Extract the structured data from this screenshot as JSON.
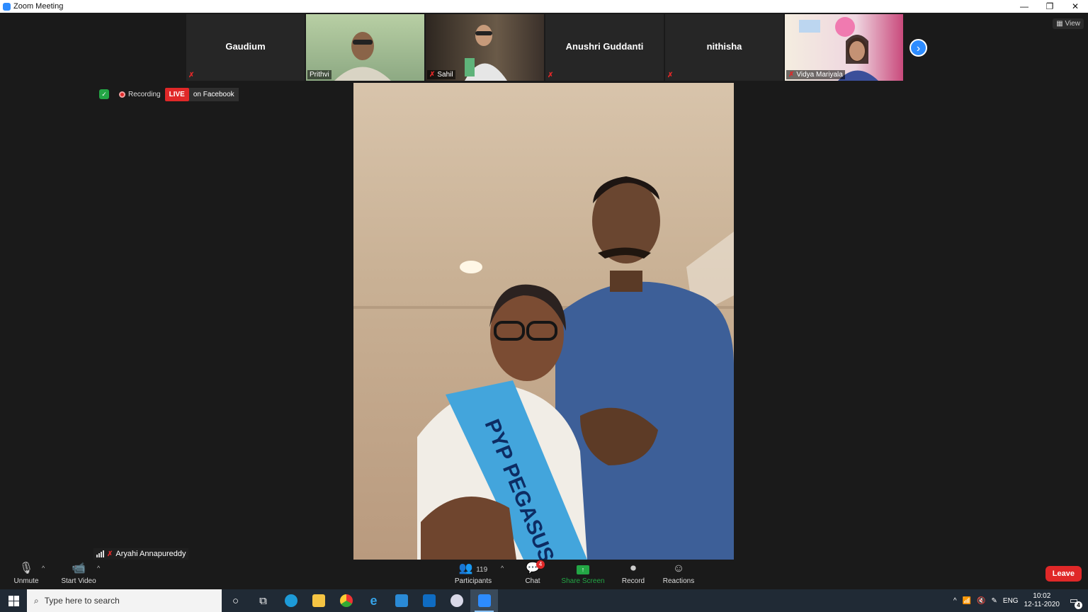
{
  "window": {
    "title": "Zoom Meeting",
    "minimize": "—",
    "restore": "❐",
    "close": "✕"
  },
  "top_right": {
    "view_label": "View"
  },
  "participants_strip": [
    {
      "name": "Gaudium",
      "type": "name-only",
      "muted": true
    },
    {
      "name": "Prithvi",
      "type": "video",
      "muted": false,
      "bg": "#9bb590"
    },
    {
      "name": "Sahil",
      "type": "video",
      "muted": true,
      "bg": "#4a4038"
    },
    {
      "name": "Anushri Guddanti",
      "type": "name-only",
      "muted": true
    },
    {
      "name": "nithisha",
      "type": "name-only",
      "muted": true
    },
    {
      "name": "Vidya Mariyala",
      "type": "video",
      "muted": true,
      "bg": "#d9a8b8"
    }
  ],
  "status": {
    "recording_label": "Recording",
    "live_label": "LIVE",
    "destination": "on Facebook"
  },
  "main_speaker": {
    "name": "Aryahi Annapureddy",
    "sash_text": "PYP PEGASUS"
  },
  "toolbar": {
    "unmute": "Unmute",
    "start_video": "Start Video",
    "participants_label": "Participants",
    "participants_count": "119",
    "chat_label": "Chat",
    "chat_badge": "4",
    "share_screen": "Share Screen",
    "record": "Record",
    "reactions": "Reactions",
    "leave": "Leave"
  },
  "taskbar": {
    "search_placeholder": "Type here to search",
    "language": "ENG",
    "time": "10:02",
    "date": "12-11-2020",
    "notification_count": "4"
  },
  "colors": {
    "zoom_blue": "#2d8cff",
    "live_red": "#e02828",
    "share_green": "#23a645"
  }
}
